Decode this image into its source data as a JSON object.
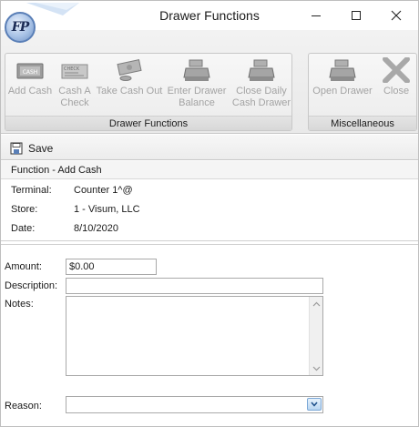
{
  "window": {
    "title": "Drawer Functions",
    "logo_text": "FP"
  },
  "ribbon": {
    "groups": [
      {
        "label": "Drawer Functions",
        "buttons": [
          {
            "label_line1": "Add Cash",
            "label_line2": "",
            "icon": "cash-register-icon"
          },
          {
            "label_line1": "Cash A",
            "label_line2": "Check",
            "icon": "check-icon"
          },
          {
            "label_line1": "Take Cash Out",
            "label_line2": "",
            "icon": "money-out-icon"
          },
          {
            "label_line1": "Enter Drawer",
            "label_line2": "Balance",
            "icon": "register-icon"
          },
          {
            "label_line1": "Close Daily",
            "label_line2": "Cash Drawer",
            "icon": "register-close-icon"
          }
        ]
      },
      {
        "label": "Miscellaneous",
        "buttons": [
          {
            "label_line1": "Open Drawer",
            "label_line2": "",
            "icon": "register-open-icon"
          },
          {
            "label_line1": "Close",
            "label_line2": "",
            "icon": "close-x-icon"
          }
        ]
      }
    ],
    "icon_texts": {
      "cash": "CASH",
      "check": "CHECK"
    }
  },
  "toolbar": {
    "save_label": "Save"
  },
  "info": {
    "header": "Function - Add Cash",
    "rows": [
      {
        "label": "Terminal:",
        "value": "Counter 1^@"
      },
      {
        "label": "Store:",
        "value": "1 - Visum, LLC"
      },
      {
        "label": "Date:",
        "value": "8/10/2020"
      }
    ]
  },
  "form": {
    "amount_label": "Amount:",
    "amount_value": "$0.00",
    "description_label": "Description:",
    "description_value": "",
    "notes_label": "Notes:",
    "notes_value": "",
    "reason_label": "Reason:",
    "reason_value": ""
  },
  "colors": {
    "disabled_text": "#a3a3a3",
    "ribbon_bg": "#ececec",
    "accent_blue": "#5a7fb7"
  }
}
